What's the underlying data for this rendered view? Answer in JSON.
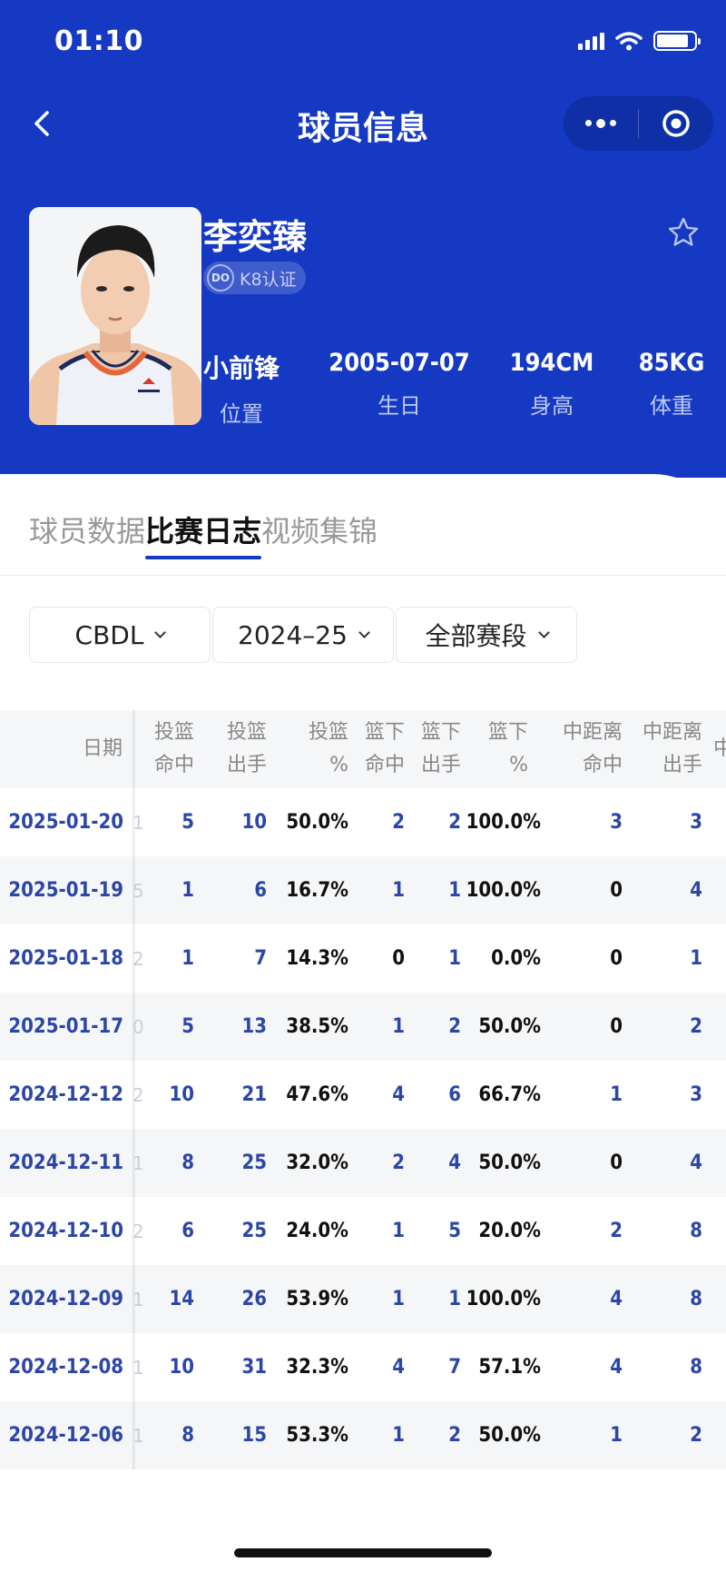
{
  "status_bar": {
    "time": "01:10"
  },
  "nav": {
    "title": "球员信息"
  },
  "player": {
    "name": "李奕臻",
    "cert_icon_text": "DO",
    "certification": "K8认证",
    "stats": [
      {
        "value": "小前锋",
        "label": "位置"
      },
      {
        "value": "2005-07-07",
        "label": "生日"
      },
      {
        "value": "194CM",
        "label": "身高"
      },
      {
        "value": "85KG",
        "label": "体重"
      }
    ]
  },
  "tabs": [
    {
      "label": "球员数据",
      "active": false
    },
    {
      "label": "比赛日志",
      "active": true
    },
    {
      "label": "视频集锦",
      "active": false
    }
  ],
  "filters": [
    {
      "label": "CBDL"
    },
    {
      "label": "2024–25"
    },
    {
      "label": "全部赛段"
    }
  ],
  "table": {
    "date_header": "日期",
    "headers": [
      [
        "投篮",
        "命中"
      ],
      [
        "投篮",
        "出手"
      ],
      [
        "投篮",
        "%"
      ],
      [
        "篮下",
        "命中"
      ],
      [
        "篮下",
        "出手"
      ],
      [
        "篮下",
        "%"
      ],
      [
        "中距离",
        "命中"
      ],
      [
        "中距离",
        "出手"
      ],
      [
        "中",
        ""
      ]
    ],
    "rows": [
      {
        "date": "2025-01-20",
        "cells": [
          "5",
          "10",
          "50.0%",
          "2",
          "2",
          "100.0%",
          "3",
          "3"
        ]
      },
      {
        "date": "2025-01-19",
        "cells": [
          "1",
          "6",
          "16.7%",
          "1",
          "1",
          "100.0%",
          "0",
          "4"
        ]
      },
      {
        "date": "2025-01-18",
        "cells": [
          "1",
          "7",
          "14.3%",
          "0",
          "1",
          "0.0%",
          "0",
          "1"
        ]
      },
      {
        "date": "2025-01-17",
        "cells": [
          "5",
          "13",
          "38.5%",
          "1",
          "2",
          "50.0%",
          "0",
          "2"
        ]
      },
      {
        "date": "2024-12-12",
        "cells": [
          "10",
          "21",
          "47.6%",
          "4",
          "6",
          "66.7%",
          "1",
          "3"
        ]
      },
      {
        "date": "2024-12-11",
        "cells": [
          "8",
          "25",
          "32.0%",
          "2",
          "4",
          "50.0%",
          "0",
          "4"
        ]
      },
      {
        "date": "2024-12-10",
        "cells": [
          "6",
          "25",
          "24.0%",
          "1",
          "5",
          "20.0%",
          "2",
          "8"
        ]
      },
      {
        "date": "2024-12-09",
        "cells": [
          "14",
          "26",
          "53.9%",
          "1",
          "1",
          "100.0%",
          "4",
          "8"
        ]
      },
      {
        "date": "2024-12-08",
        "cells": [
          "10",
          "31",
          "32.3%",
          "4",
          "7",
          "57.1%",
          "4",
          "8"
        ]
      },
      {
        "date": "2024-12-06",
        "cells": [
          "8",
          "15",
          "53.3%",
          "1",
          "2",
          "50.0%",
          "1",
          "2"
        ]
      }
    ],
    "row_fragments": [
      "1",
      "5",
      "2",
      "0",
      "2",
      "1",
      "2",
      "1",
      "1",
      "1"
    ]
  },
  "colors": {
    "header_blue": "#1539c3",
    "value_blue": "#2c46a8",
    "row_alt": "#f5f6f8"
  }
}
